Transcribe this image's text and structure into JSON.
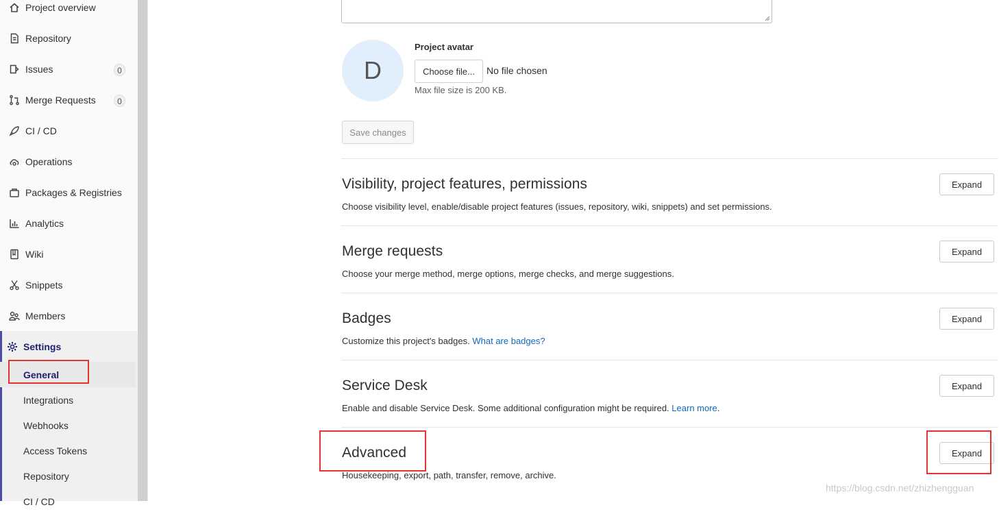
{
  "sidebar": {
    "items": [
      {
        "label": "Project overview",
        "icon": "home-icon"
      },
      {
        "label": "Repository",
        "icon": "document-icon"
      },
      {
        "label": "Issues",
        "icon": "issues-icon",
        "count": "0"
      },
      {
        "label": "Merge Requests",
        "icon": "merge-request-icon",
        "count": "0"
      },
      {
        "label": "CI / CD",
        "icon": "rocket-icon"
      },
      {
        "label": "Operations",
        "icon": "cloud-gear-icon"
      },
      {
        "label": "Packages & Registries",
        "icon": "package-icon"
      },
      {
        "label": "Analytics",
        "icon": "chart-icon"
      },
      {
        "label": "Wiki",
        "icon": "book-icon"
      },
      {
        "label": "Snippets",
        "icon": "scissors-icon"
      },
      {
        "label": "Members",
        "icon": "users-icon"
      }
    ],
    "settings": {
      "label": "Settings",
      "icon": "gear-icon",
      "sub_items": [
        "General",
        "Integrations",
        "Webhooks",
        "Access Tokens",
        "Repository",
        "CI / CD"
      ],
      "active": "General"
    }
  },
  "avatar": {
    "letter": "D",
    "title": "Project avatar",
    "choose_label": "Choose file...",
    "file_status": "No file chosen",
    "help": "Max file size is 200 KB."
  },
  "save_label": "Save changes",
  "sections": [
    {
      "title": "Visibility, project features, permissions",
      "description": "Choose visibility level, enable/disable project features (issues, repository, wiki, snippets) and set permissions.",
      "button": "Expand"
    },
    {
      "title": "Merge requests",
      "description": "Choose your merge method, merge options, merge checks, and merge suggestions.",
      "button": "Expand"
    },
    {
      "title": "Badges",
      "description": "Customize this project's badges. ",
      "link": "What are badges?",
      "button": "Expand"
    },
    {
      "title": "Service Desk",
      "description": "Enable and disable Service Desk. Some additional configuration might be required. ",
      "link": "Learn more",
      "suffix": ".",
      "button": "Expand"
    },
    {
      "title": "Advanced",
      "description": "Housekeeping, export, path, transfer, remove, archive.",
      "button": "Expand"
    }
  ],
  "watermark": "https://blog.csdn.net/zhizhengguan",
  "colors": {
    "accent": "#1f1f6e",
    "link": "#1068bf",
    "annotation": "#e5322c",
    "avatar_bg": "#e1eefc"
  }
}
